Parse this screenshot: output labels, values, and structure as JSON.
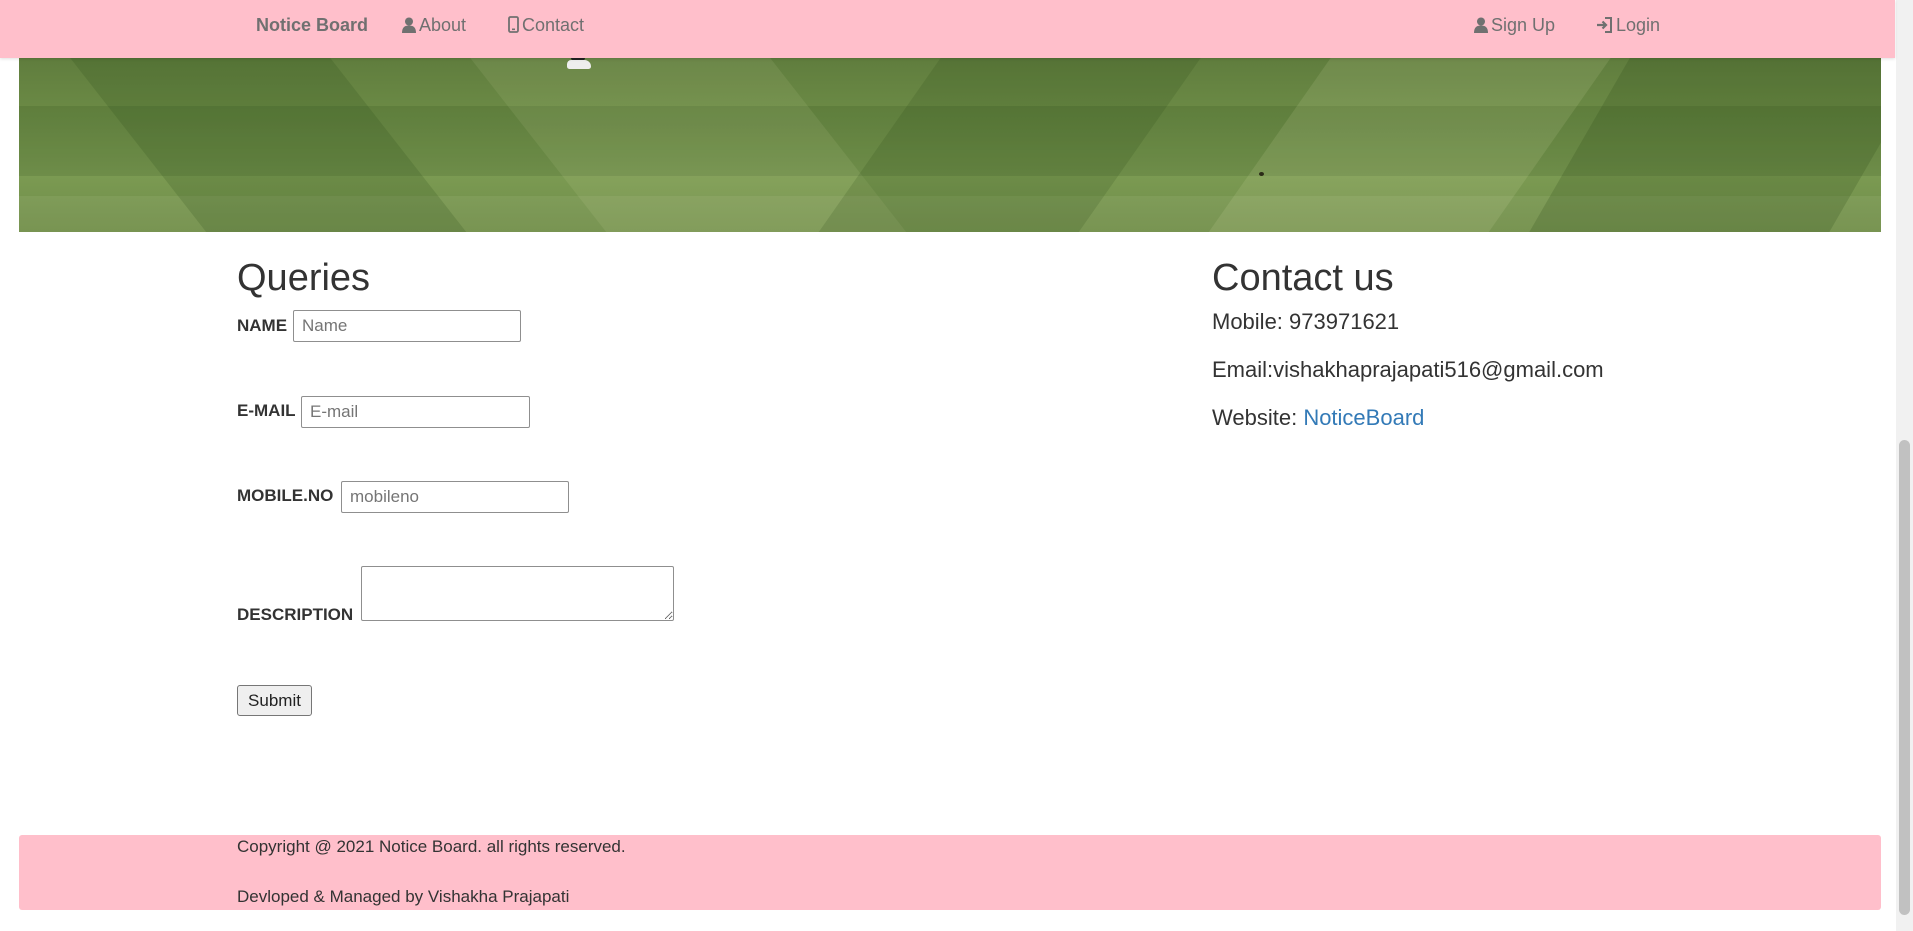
{
  "nav": {
    "brand": "Notice Board",
    "about": "About",
    "contact": "Contact",
    "signup": "Sign Up",
    "login": "Login",
    "background": "#ffbfcb"
  },
  "queries": {
    "title": "Queries",
    "name_label": "NAME",
    "name_placeholder": "Name",
    "email_label": "E-MAIL",
    "email_placeholder": "E-mail",
    "mobile_label": "MOBILE.NO",
    "mobile_placeholder": "mobileno",
    "description_label": "DESCRIPTION",
    "submit_label": "Submit"
  },
  "contact": {
    "title": "Contact us",
    "mobile": "Mobile: 973971621",
    "email": "Email:vishakhaprajapati516@gmail.com",
    "website_prefix": "Website: ",
    "website_link": "NoticeBoard",
    "link_color": "#337ab7"
  },
  "footer": {
    "copyright": "Copyright @ 2021 Notice Board. all rights reserved.",
    "credit": "Devloped & Managed by Vishakha Prajapati",
    "background": "#ffbfcb"
  }
}
